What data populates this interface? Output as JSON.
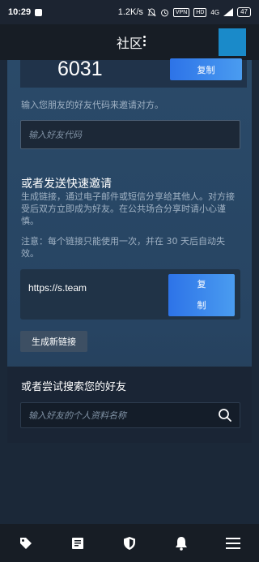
{
  "status_bar": {
    "time": "10:29",
    "speed": "1.2K/s",
    "vpn": "VPN",
    "hd": "HD",
    "network": "4G",
    "battery": "47"
  },
  "header": {
    "title": "社区"
  },
  "invite": {
    "code": "6031",
    "copy_label": "复制",
    "description": "输入您朋友的好友代码来邀请对方。",
    "friend_code_placeholder": "输入好友代码"
  },
  "quick_invite": {
    "title": "或者发送快速邀请",
    "description": "生成链接，通过电子邮件或短信分享给其他人。对方接受后双方立即成为好友。在公共场合分享时请小心谨慎。",
    "note": "注意：每个链接只能使用一次，并在 30 天后自动失效。",
    "link": "https://s.team",
    "copy_line1": "复",
    "copy_line2": "制",
    "generate_label": "生成新链接"
  },
  "search": {
    "title": "或者尝试搜索您的好友",
    "placeholder": "输入好友的个人资料名称"
  },
  "nav": {
    "items": [
      "store-icon",
      "library-icon",
      "community-icon",
      "notifications-icon",
      "menu-icon"
    ]
  },
  "colors": {
    "accent": "#2d73e8",
    "background": "#1b2838"
  }
}
